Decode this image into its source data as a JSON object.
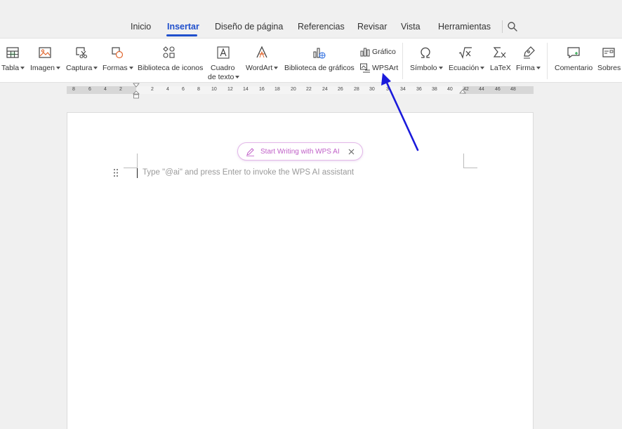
{
  "tabs": [
    {
      "label": "Inicio"
    },
    {
      "label": "Insertar"
    },
    {
      "label": "Diseño de página"
    },
    {
      "label": "Referencias"
    },
    {
      "label": "Revisar"
    },
    {
      "label": "Vista"
    },
    {
      "label": "Herramientas"
    }
  ],
  "active_tab": "Insertar",
  "ribbon": {
    "tabla": "Tabla",
    "imagen": "Imagen",
    "captura": "Captura",
    "formas": "Formas",
    "iconos": "Biblioteca de iconos",
    "cuadro_1": "Cuadro",
    "cuadro_2": "de texto",
    "wordart": "WordArt",
    "graficos": "Biblioteca de gráficos",
    "grafico": "Gráfico",
    "wpsart": "WPSArt",
    "simbolo": "Símbolo",
    "ecuacion": "Ecuación",
    "latex": "LaTeX",
    "firma": "Firma",
    "comentario": "Comentario",
    "sobres": "Sobres"
  },
  "ruler": {
    "numbers": [
      "8",
      "6",
      "4",
      "2",
      "2",
      "4",
      "6",
      "8",
      "10",
      "12",
      "14",
      "16",
      "18",
      "20",
      "22",
      "24",
      "26",
      "28",
      "30",
      "3",
      "34",
      "36",
      "38",
      "40",
      "42",
      "44",
      "46",
      "48"
    ]
  },
  "document": {
    "ai_button": "Start Writing with WPS AI",
    "placeholder": "Type \"@ai\" and press Enter to invoke the WPS AI assistant"
  },
  "colors": {
    "accent": "#1f4fcc",
    "ai_pink": "#c060c8",
    "annotation_arrow": "#1a1adb"
  }
}
